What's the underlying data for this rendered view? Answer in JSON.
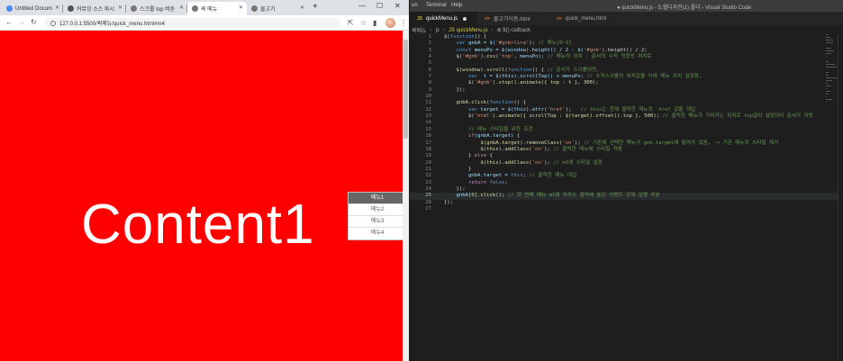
{
  "browser": {
    "tabs": [
      {
        "label": "Untitled Docum"
      },
      {
        "label": "커뮤잉 소스 파시"
      },
      {
        "label": "스크롤 top 버튼"
      },
      {
        "label": "퀵 메뉴"
      },
      {
        "label": "물고기"
      }
    ],
    "new_tab": "+",
    "win_min": "—",
    "win_max": "☐",
    "win_close": "✕",
    "back": "←",
    "forward": "→",
    "reload": "↻",
    "url": "127.0.0.1:5500/퀵메뉴/quick_menu.html#m4",
    "content_title": "Content1",
    "quick_menu": [
      "메뉴1",
      "메뉴2",
      "메뉴3",
      "메뉴4"
    ],
    "quick_menu_active": 0
  },
  "vscode": {
    "menu": [
      "un",
      "Terminal",
      "Help"
    ],
    "window_title": "● quickMenu.js - 5.웹디자인(1) 폴더 - Visual Studio Code",
    "tabs": [
      {
        "icon": "JS",
        "label": "quickMenu.js",
        "dirty": true,
        "color": "#cbcb41"
      },
      {
        "icon": "<>",
        "label": "물고기이동.html",
        "dirty": false,
        "color": "#e37933"
      },
      {
        "icon": "<>",
        "label": "quick_menu.html",
        "dirty": false,
        "color": "#e37933"
      }
    ],
    "breadcrumb": [
      "퀵메뉴",
      "js",
      "JS quickMenu.js",
      "⊕ $() callback"
    ],
    "lines": [
      [
        {
          "t": "$(",
          "c": "#d4d4d4"
        },
        {
          "t": "function",
          "c": "#569cd6"
        },
        {
          "t": "() {",
          "c": "#d4d4d4"
        }
      ],
      [
        {
          "t": "    ",
          "c": "#d4d4d4"
        },
        {
          "t": "var",
          "c": "#569cd6"
        },
        {
          "t": " gnbA = $(",
          "c": "#9cdcfe"
        },
        {
          "t": "'#gnb>li>a'",
          "c": "#ce9178"
        },
        {
          "t": "); ",
          "c": "#d4d4d4"
        },
        {
          "t": "// 메뉴[0~3]",
          "c": "#6a9955"
        }
      ],
      [
        {
          "t": "    ",
          "c": "#d4d4d4"
        },
        {
          "t": "const",
          "c": "#569cd6"
        },
        {
          "t": " menuPo = $(window).height() / 2 - $(",
          "c": "#9cdcfe"
        },
        {
          "t": "'#gnb'",
          "c": "#ce9178"
        },
        {
          "t": ").height() / 2;",
          "c": "#d4d4d4"
        }
      ],
      [
        {
          "t": "    $(",
          "c": "#d4d4d4"
        },
        {
          "t": "'#gnb'",
          "c": "#ce9178"
        },
        {
          "t": ").css(",
          "c": "#dcdcaa"
        },
        {
          "t": "'top'",
          "c": "#ce9178"
        },
        {
          "t": ", menuPo); ",
          "c": "#9cdcfe"
        },
        {
          "t": "// 메뉴의 위치 : 문서의 수직 정중앙 위치로",
          "c": "#6a9955"
        }
      ],
      [
        {
          "t": "",
          "c": "#d4d4d4"
        }
      ],
      [
        {
          "t": "    $(window).scroll(",
          "c": "#dcdcaa"
        },
        {
          "t": "function",
          "c": "#569cd6"
        },
        {
          "t": "() { ",
          "c": "#d4d4d4"
        },
        {
          "t": "// 문서가 스크롤되면,",
          "c": "#6a9955"
        }
      ],
      [
        {
          "t": "        ",
          "c": "#d4d4d4"
        },
        {
          "t": "var",
          "c": "#569cd6"
        },
        {
          "t": "  t = $(this).scrollTop() + menuPo; ",
          "c": "#9cdcfe"
        },
        {
          "t": "// 수직스크롤의 위치값을 더해 메뉴 위치 설정함,",
          "c": "#6a9955"
        }
      ],
      [
        {
          "t": "        $(",
          "c": "#d4d4d4"
        },
        {
          "t": "'#gnb'",
          "c": "#ce9178"
        },
        {
          "t": ").stop().animate({ top : t }, 300);",
          "c": "#dcdcaa"
        }
      ],
      [
        {
          "t": "    });",
          "c": "#d4d4d4"
        }
      ],
      [
        {
          "t": "",
          "c": "#d4d4d4"
        }
      ],
      [
        {
          "t": "    gnbA.click(",
          "c": "#dcdcaa"
        },
        {
          "t": "function",
          "c": "#569cd6"
        },
        {
          "t": "() {",
          "c": "#d4d4d4"
        }
      ],
      [
        {
          "t": "        ",
          "c": "#d4d4d4"
        },
        {
          "t": "var",
          "c": "#569cd6"
        },
        {
          "t": " target = $(this).attr(",
          "c": "#9cdcfe"
        },
        {
          "t": "'href'",
          "c": "#ce9178"
        },
        {
          "t": ");   ",
          "c": "#d4d4d4"
        },
        {
          "t": "// this는 현재 클릭한 메뉴의  href 값을 대입",
          "c": "#6a9955"
        }
      ],
      [
        {
          "t": "        $(",
          "c": "#d4d4d4"
        },
        {
          "t": "'html'",
          "c": "#ce9178"
        },
        {
          "t": ").animate({ scrollTop : $(target).offset().top }, 500); ",
          "c": "#dcdcaa"
        },
        {
          "t": "// 클릭한 메뉴가 가리키는 위치로 top값이 설정되어 문서가 이동",
          "c": "#6a9955"
        }
      ],
      [
        {
          "t": "",
          "c": "#d4d4d4"
        }
      ],
      [
        {
          "t": "        ",
          "c": "#d4d4d4"
        },
        {
          "t": "// 메뉴 스타일을 위한 조건",
          "c": "#6a9955"
        }
      ],
      [
        {
          "t": "        ",
          "c": "#d4d4d4"
        },
        {
          "t": "if",
          "c": "#c586c0"
        },
        {
          "t": "(gnbA.target) {",
          "c": "#9cdcfe"
        }
      ],
      [
        {
          "t": "            $(gnbA.target).removeClass(",
          "c": "#dcdcaa"
        },
        {
          "t": "'on'",
          "c": "#ce9178"
        },
        {
          "t": "); ",
          "c": "#d4d4d4"
        },
        {
          "t": "// 기존에 선택한 메뉴가 gnb.target에 들어가 있음, -> 기존 메뉴의 스타일 제거",
          "c": "#6a9955"
        }
      ],
      [
        {
          "t": "            $(this).addClass(",
          "c": "#dcdcaa"
        },
        {
          "t": "'on'",
          "c": "#ce9178"
        },
        {
          "t": "); ",
          "c": "#d4d4d4"
        },
        {
          "t": "// 클릭한 메뉴에 스타일 적용",
          "c": "#6a9955"
        }
      ],
      [
        {
          "t": "        } ",
          "c": "#d4d4d4"
        },
        {
          "t": "else",
          "c": "#c586c0"
        },
        {
          "t": " {",
          "c": "#d4d4d4"
        }
      ],
      [
        {
          "t": "            $(this).addClass(",
          "c": "#dcdcaa"
        },
        {
          "t": "'on'",
          "c": "#ce9178"
        },
        {
          "t": "); ",
          "c": "#d4d4d4"
        },
        {
          "t": "// m1에 스타일 설정",
          "c": "#6a9955"
        }
      ],
      [
        {
          "t": "        }",
          "c": "#d4d4d4"
        }
      ],
      [
        {
          "t": "        gnbA.target = ",
          "c": "#9cdcfe"
        },
        {
          "t": "this",
          "c": "#569cd6"
        },
        {
          "t": "; ",
          "c": "#d4d4d4"
        },
        {
          "t": "// 클릭한 메뉴 대입",
          "c": "#6a9955"
        }
      ],
      [
        {
          "t": "        ",
          "c": "#d4d4d4"
        },
        {
          "t": "return",
          "c": "#c586c0"
        },
        {
          "t": " ",
          "c": "#d4d4d4"
        },
        {
          "t": "false",
          "c": "#569cd6"
        },
        {
          "t": ";",
          "c": "#d4d4d4"
        }
      ],
      [
        {
          "t": "    });",
          "c": "#d4d4d4"
        }
      ],
      [
        {
          "t": "    gnbA[",
          "c": "#9cdcfe"
        },
        {
          "t": "0",
          "c": "#b5cea8"
        },
        {
          "t": "].click(); ",
          "c": "#dcdcaa"
        },
        {
          "t": "// 첫 번째 메뉴 m1에 마우스 클릭해 놓은 이벤트 강제 실행 부분",
          "c": "#6a9955"
        }
      ],
      [
        {
          "t": "});",
          "c": "#d4d4d4"
        }
      ],
      [
        {
          "t": "",
          "c": "#d4d4d4"
        }
      ]
    ],
    "current_line": 25
  }
}
